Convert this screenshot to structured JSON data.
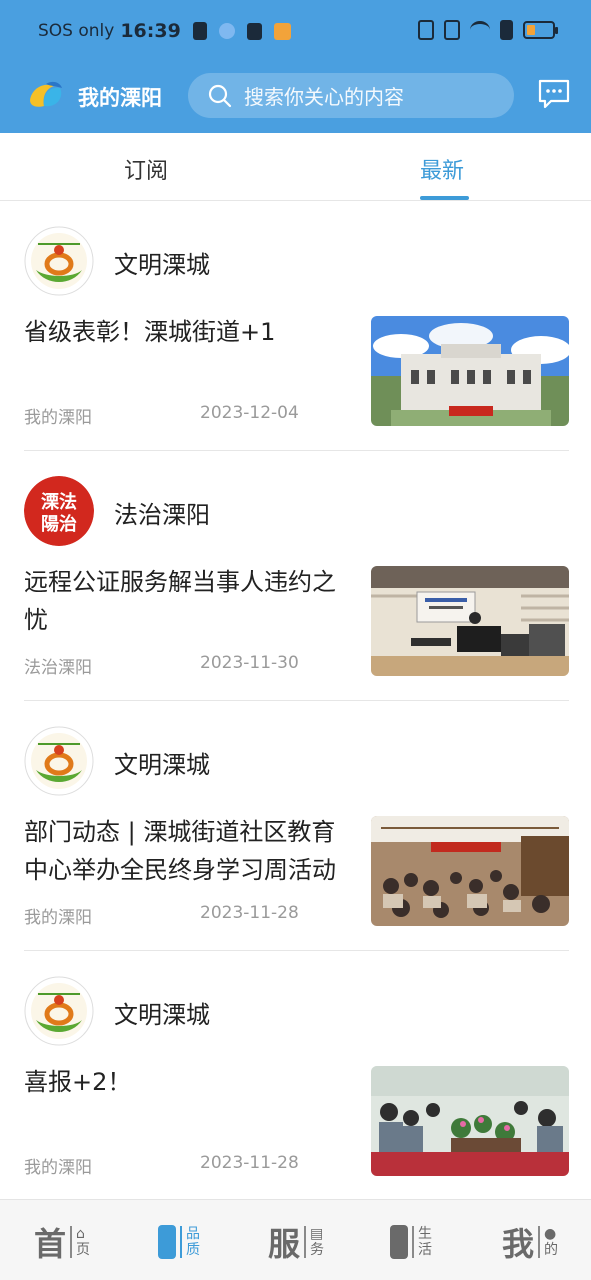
{
  "status_bar": {
    "carrier": "SOS only",
    "time": "16:39"
  },
  "header": {
    "title": "我的溧阳",
    "search_placeholder": "搜索你关心的内容",
    "colors": {
      "brand": "#4a9fe0",
      "accent": "#3d9bd8"
    }
  },
  "tabs": [
    {
      "label": "订阅",
      "active": false
    },
    {
      "label": "最新",
      "active": true
    }
  ],
  "feed": [
    {
      "source": "文明溧城",
      "headline": "省级表彰！溧城街道+1",
      "meta_source": "我的溧阳",
      "date": "2023-12-04",
      "avatar": "civilization-logo"
    },
    {
      "source": "法治溧阳",
      "headline": "远程公证服务解当事人违约之忧",
      "meta_source": "法治溧阳",
      "date": "2023-11-30",
      "avatar": "law-seal",
      "avatar_text": [
        "溧法",
        "陽治"
      ]
    },
    {
      "source": "文明溧城",
      "headline": "部门动态 | 溧城街道社区教育中心举办全民终身学习周活动",
      "meta_source": "我的溧阳",
      "date": "2023-11-28",
      "avatar": "civilization-logo"
    },
    {
      "source": "文明溧城",
      "headline": "喜报+2！",
      "meta_source": "我的溧阳",
      "date": "2023-11-28",
      "avatar": "civilization-logo"
    }
  ],
  "bottom_nav": [
    {
      "big": "首",
      "small": [
        "页"
      ],
      "active": false
    },
    {
      "big": "",
      "small": [
        "品",
        "质"
      ],
      "active": true,
      "icon": "quality-icon"
    },
    {
      "big": "服",
      "small": [
        "务"
      ],
      "active": false
    },
    {
      "big": "",
      "small": [
        "生",
        "活"
      ],
      "active": false,
      "icon": "life-icon"
    },
    {
      "big": "我",
      "small": [
        "的"
      ],
      "active": false
    }
  ]
}
